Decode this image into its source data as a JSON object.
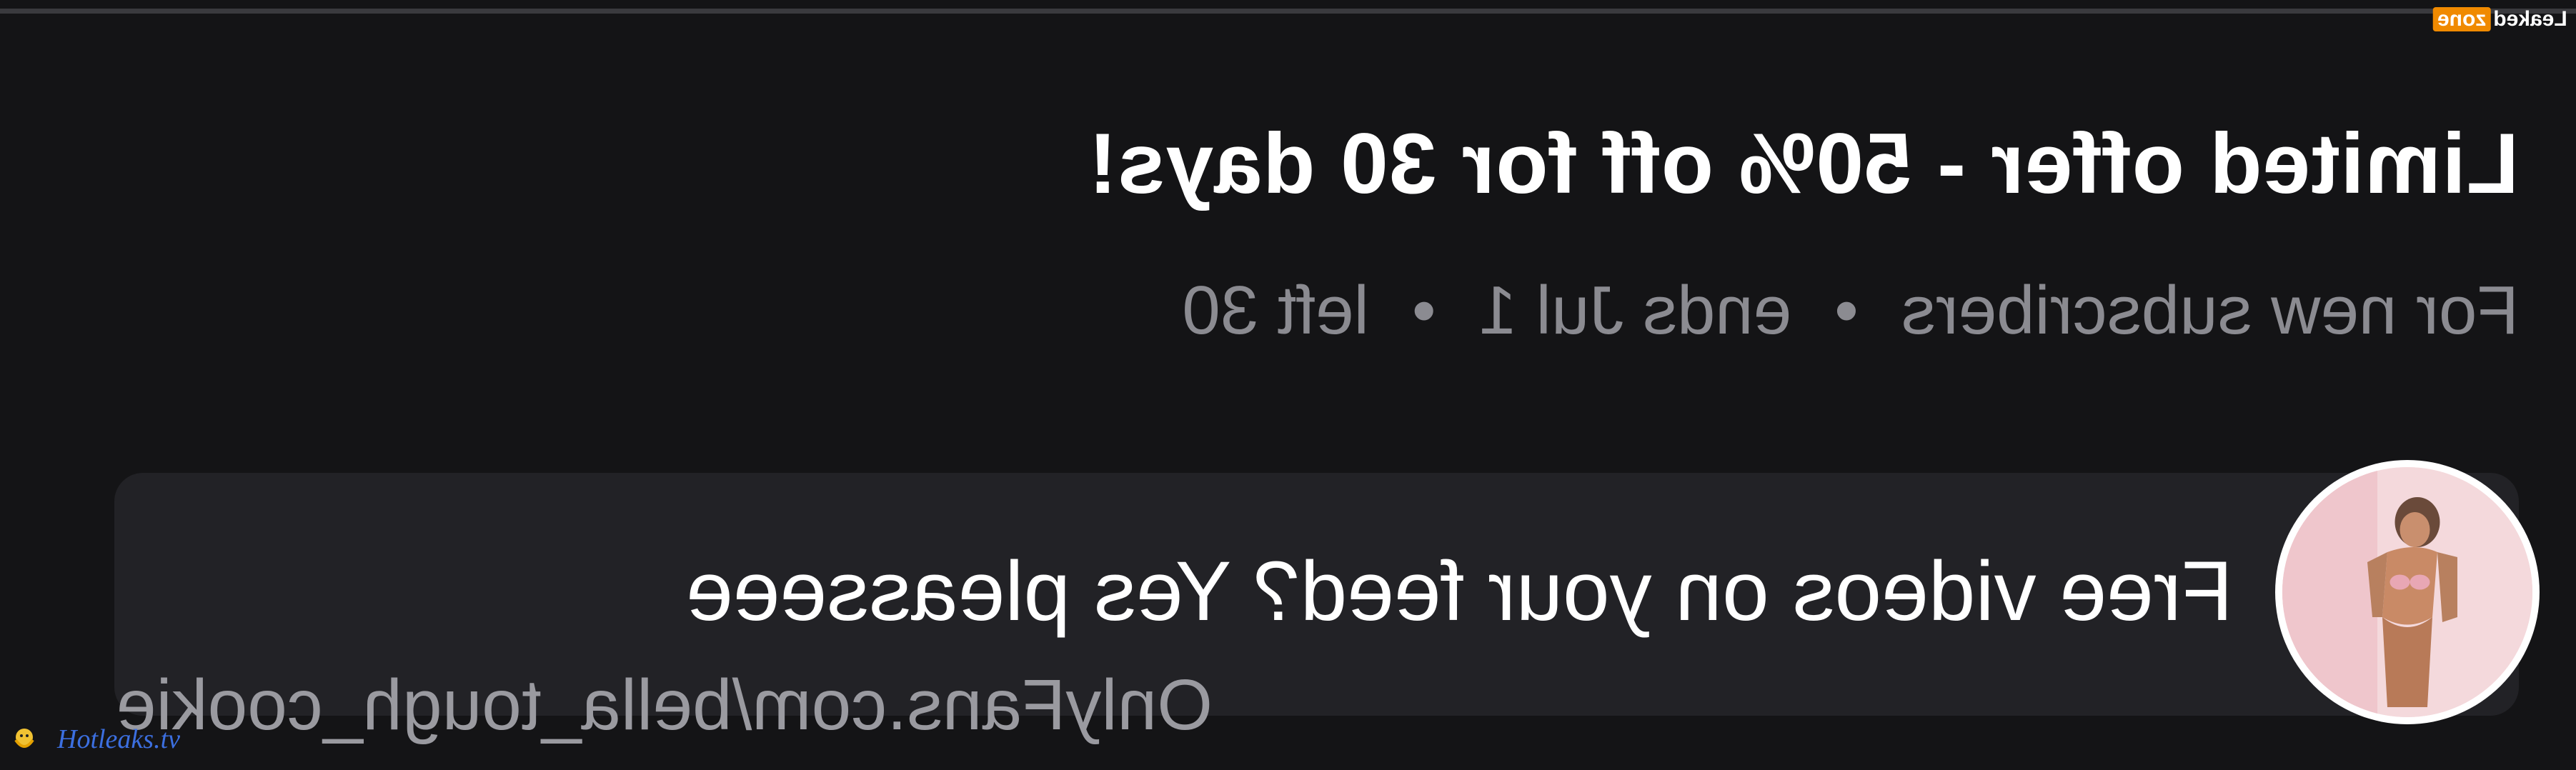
{
  "offer": {
    "title": "Limited offer - 50% off for 30 days!",
    "audience": "For new subscribers",
    "ends": "ends Jul 1",
    "left": "left 30",
    "separator": "•"
  },
  "post": {
    "text": "Free videos on your feed? Yes pleasseee",
    "link": "OnlyFans.com/bella_tough_cookie"
  },
  "watermarks": {
    "top_left_part": "Leaked",
    "top_right_part": "zone",
    "bottom": "Hotleaks.tv"
  },
  "colors": {
    "background": "#141416",
    "card": "#222226",
    "title": "#ffffff",
    "meta": "#8b8b91",
    "zone_badge": "#f08a00",
    "hotleaks": "#3c6fe0"
  }
}
